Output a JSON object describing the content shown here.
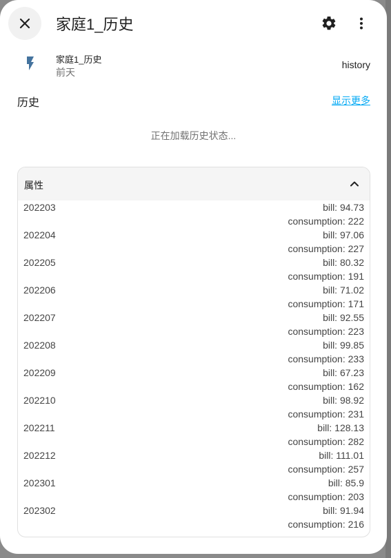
{
  "header": {
    "title": "家庭1_历史"
  },
  "entity": {
    "name": "家庭1_历史",
    "time": "前天",
    "state": "history"
  },
  "history": {
    "heading": "历史",
    "show_more": "显示更多",
    "loading": "正在加载历史状态..."
  },
  "attributes": {
    "title": "属性",
    "rows": [
      {
        "key": "202203",
        "bill": "bill: 94.73",
        "consumption": "consumption: 222"
      },
      {
        "key": "202204",
        "bill": "bill: 97.06",
        "consumption": "consumption: 227"
      },
      {
        "key": "202205",
        "bill": "bill: 80.32",
        "consumption": "consumption: 191"
      },
      {
        "key": "202206",
        "bill": "bill: 71.02",
        "consumption": "consumption: 171"
      },
      {
        "key": "202207",
        "bill": "bill: 92.55",
        "consumption": "consumption: 223"
      },
      {
        "key": "202208",
        "bill": "bill: 99.85",
        "consumption": "consumption: 233"
      },
      {
        "key": "202209",
        "bill": "bill: 67.23",
        "consumption": "consumption: 162"
      },
      {
        "key": "202210",
        "bill": "bill: 98.92",
        "consumption": "consumption: 231"
      },
      {
        "key": "202211",
        "bill": "bill: 128.13",
        "consumption": "consumption: 282"
      },
      {
        "key": "202212",
        "bill": "bill: 111.01",
        "consumption": "consumption: 257"
      },
      {
        "key": "202301",
        "bill": "bill: 85.9",
        "consumption": "consumption: 203"
      },
      {
        "key": "202302",
        "bill": "bill: 91.94",
        "consumption": "consumption: 216"
      }
    ]
  },
  "colors": {
    "accent": "#03a9f4",
    "entity_icon": "#44739e"
  }
}
